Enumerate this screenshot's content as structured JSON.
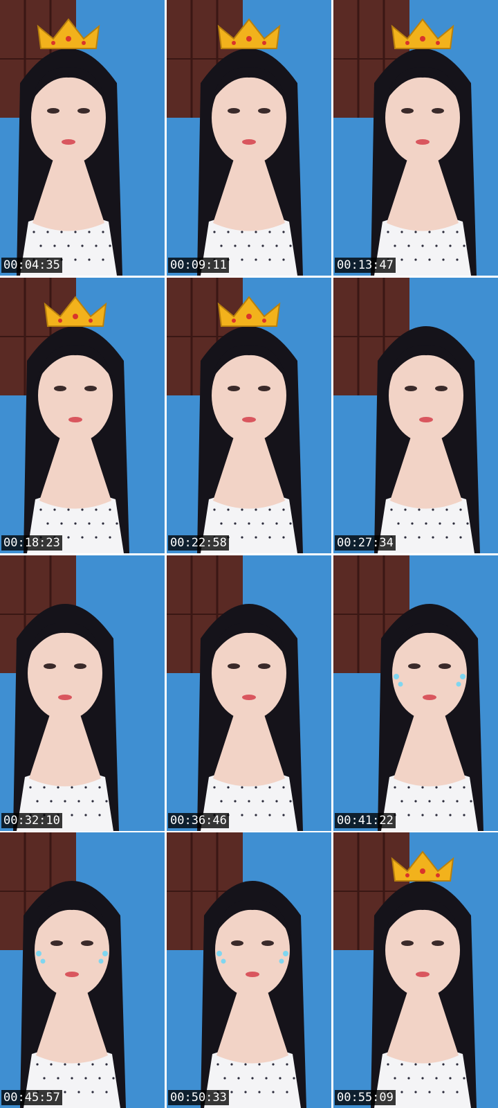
{
  "frames": [
    {
      "timestamp": "00:04:35",
      "crown": true,
      "tears": false
    },
    {
      "timestamp": "00:09:11",
      "crown": true,
      "tears": false
    },
    {
      "timestamp": "00:13:47",
      "crown": true,
      "tears": false
    },
    {
      "timestamp": "00:18:23",
      "crown": true,
      "tears": false
    },
    {
      "timestamp": "00:22:58",
      "crown": true,
      "tears": false
    },
    {
      "timestamp": "00:27:34",
      "crown": false,
      "tears": false
    },
    {
      "timestamp": "00:32:10",
      "crown": false,
      "tears": false
    },
    {
      "timestamp": "00:36:46",
      "crown": false,
      "tears": false
    },
    {
      "timestamp": "00:41:22",
      "crown": false,
      "tears": true
    },
    {
      "timestamp": "00:45:57",
      "crown": false,
      "tears": true
    },
    {
      "timestamp": "00:50:33",
      "crown": false,
      "tears": true
    },
    {
      "timestamp": "00:55:09",
      "crown": true,
      "tears": false
    }
  ],
  "colors": {
    "wall": "#3f8fd2",
    "door": "#5a2a24",
    "door_line": "#3a1714",
    "hair": "#15131a",
    "skin": "#f2d3c6",
    "top": "#f4f4f6",
    "dot": "#2b2b3a",
    "crown": "#f2b21c",
    "tear": "#7fd6f0"
  }
}
